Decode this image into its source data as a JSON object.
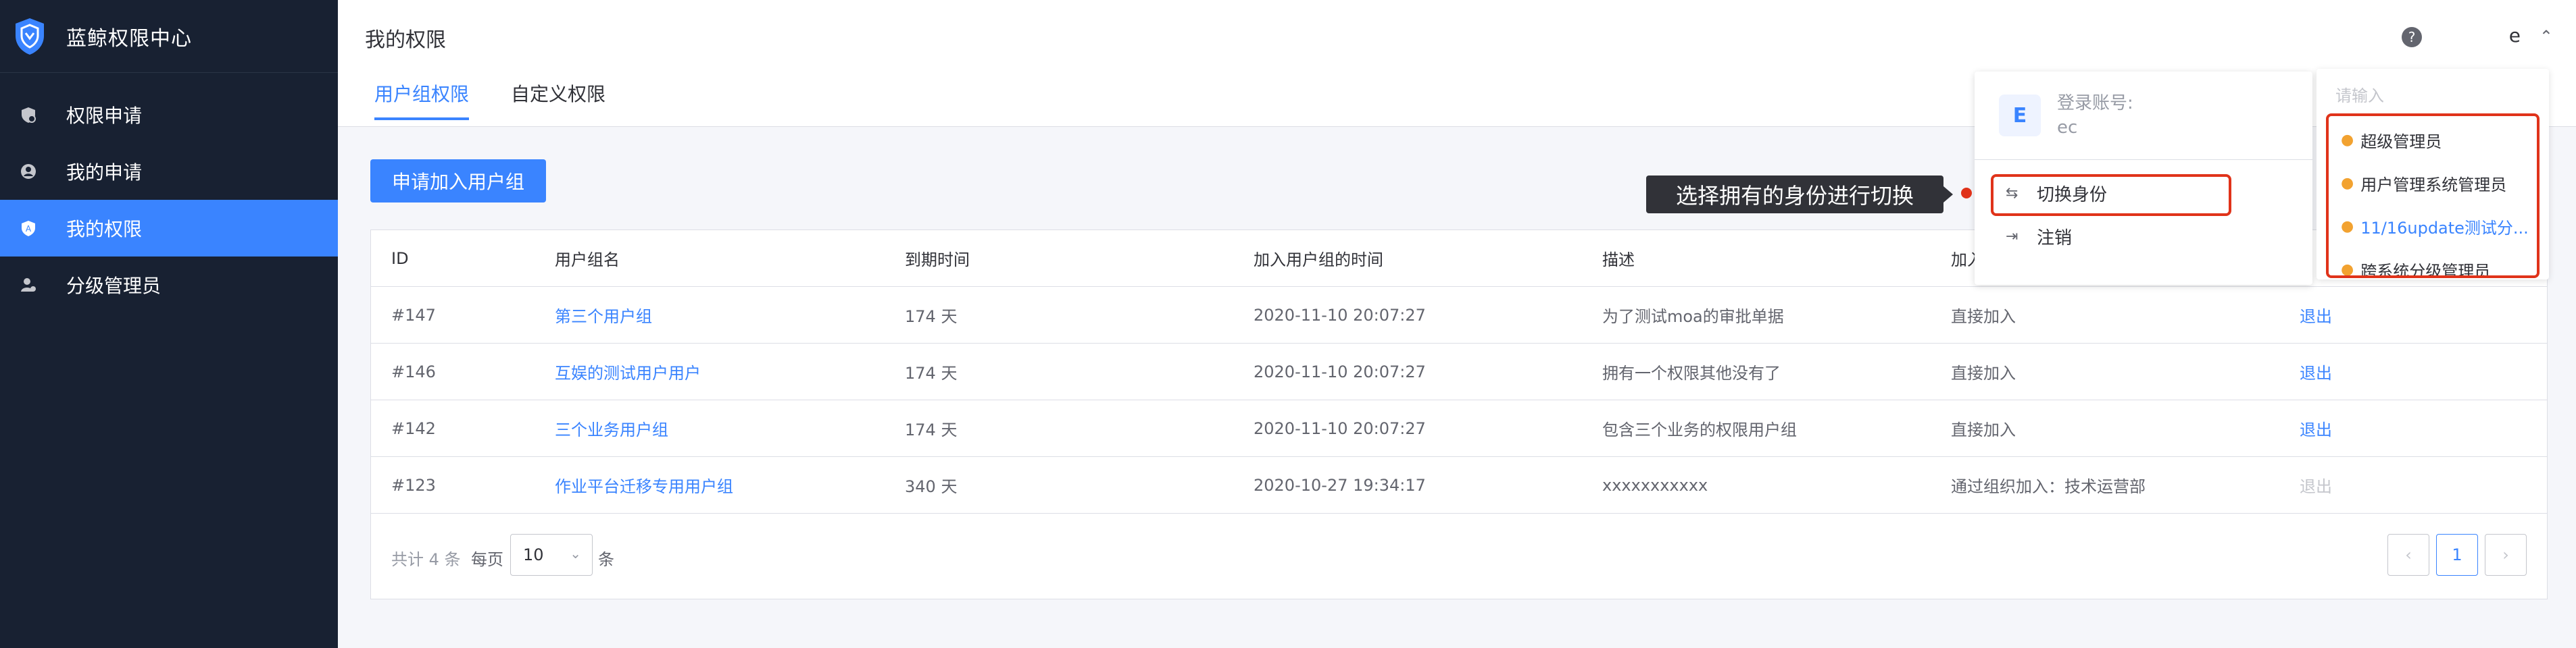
{
  "app": {
    "title": "蓝鲸权限中心"
  },
  "sidebar": {
    "items": [
      {
        "label": "权限申请",
        "icon": "apply-permission-icon"
      },
      {
        "label": "我的申请",
        "icon": "my-application-icon"
      },
      {
        "label": "我的权限",
        "icon": "my-permission-icon",
        "active": true
      },
      {
        "label": "分级管理员",
        "icon": "grading-admin-icon"
      }
    ]
  },
  "header": {
    "page_title": "我的权限",
    "tabs": [
      {
        "label": "用户组权限",
        "active": true
      },
      {
        "label": "自定义权限"
      }
    ],
    "help_glyph": "?",
    "account": "e",
    "chevron": "⌃"
  },
  "toolbar": {
    "apply_label": "申请加入用户组"
  },
  "table": {
    "columns": [
      "ID",
      "用户组名",
      "到期时间",
      "加入用户组的时间",
      "描述",
      "加入"
    ],
    "rows": [
      {
        "id": "#147",
        "name": "第三个用户组",
        "expire": "174 天",
        "joined": "2020-11-10 20:07:27",
        "desc": "为了测试moa的审批单据",
        "method": "直接加入",
        "action": "退出"
      },
      {
        "id": "#146",
        "name": "互娱的测试用户用户",
        "expire": "174 天",
        "joined": "2020-11-10 20:07:27",
        "desc": "拥有一个权限其他没有了",
        "method": "直接加入",
        "action": "退出"
      },
      {
        "id": "#142",
        "name": "三个业务用户组",
        "expire": "174 天",
        "joined": "2020-11-10 20:07:27",
        "desc": "包含三个业务的权限用户组",
        "method": "直接加入",
        "action": "退出"
      },
      {
        "id": "#123",
        "name": "作业平台迁移专用用户组",
        "expire": "340 天",
        "joined": "2020-10-27 19:34:17",
        "desc": "xxxxxxxxxxx",
        "method": "通过组织加入：技术运营部",
        "action": "退出",
        "action_disabled": true
      }
    ]
  },
  "pagination": {
    "total": "共计 4 条",
    "per_page_label": "每页",
    "page_size": "10",
    "unit": "条",
    "current_page": "1",
    "prev_glyph": "‹",
    "next_glyph": "›"
  },
  "user_dropdown": {
    "avatar_letter": "E",
    "login_label": "登录账号:",
    "login_account": "ec",
    "switch_label": "切换身份",
    "logout_label": "注销"
  },
  "role_panel": {
    "search_placeholder": "请输入",
    "roles": [
      {
        "label": "超级管理员"
      },
      {
        "label": "用户管理系统管理员"
      },
      {
        "label": "11/16update测试分...",
        "active": true
      },
      {
        "label": "跨系统分级管理员"
      }
    ]
  },
  "tooltip": {
    "text": "选择拥有的身份进行切换"
  },
  "colors": {
    "sidebar_bg": "#182132",
    "primary": "#3a84ff",
    "highlight_red": "#e0331a",
    "role_icon": "#f2a230"
  }
}
